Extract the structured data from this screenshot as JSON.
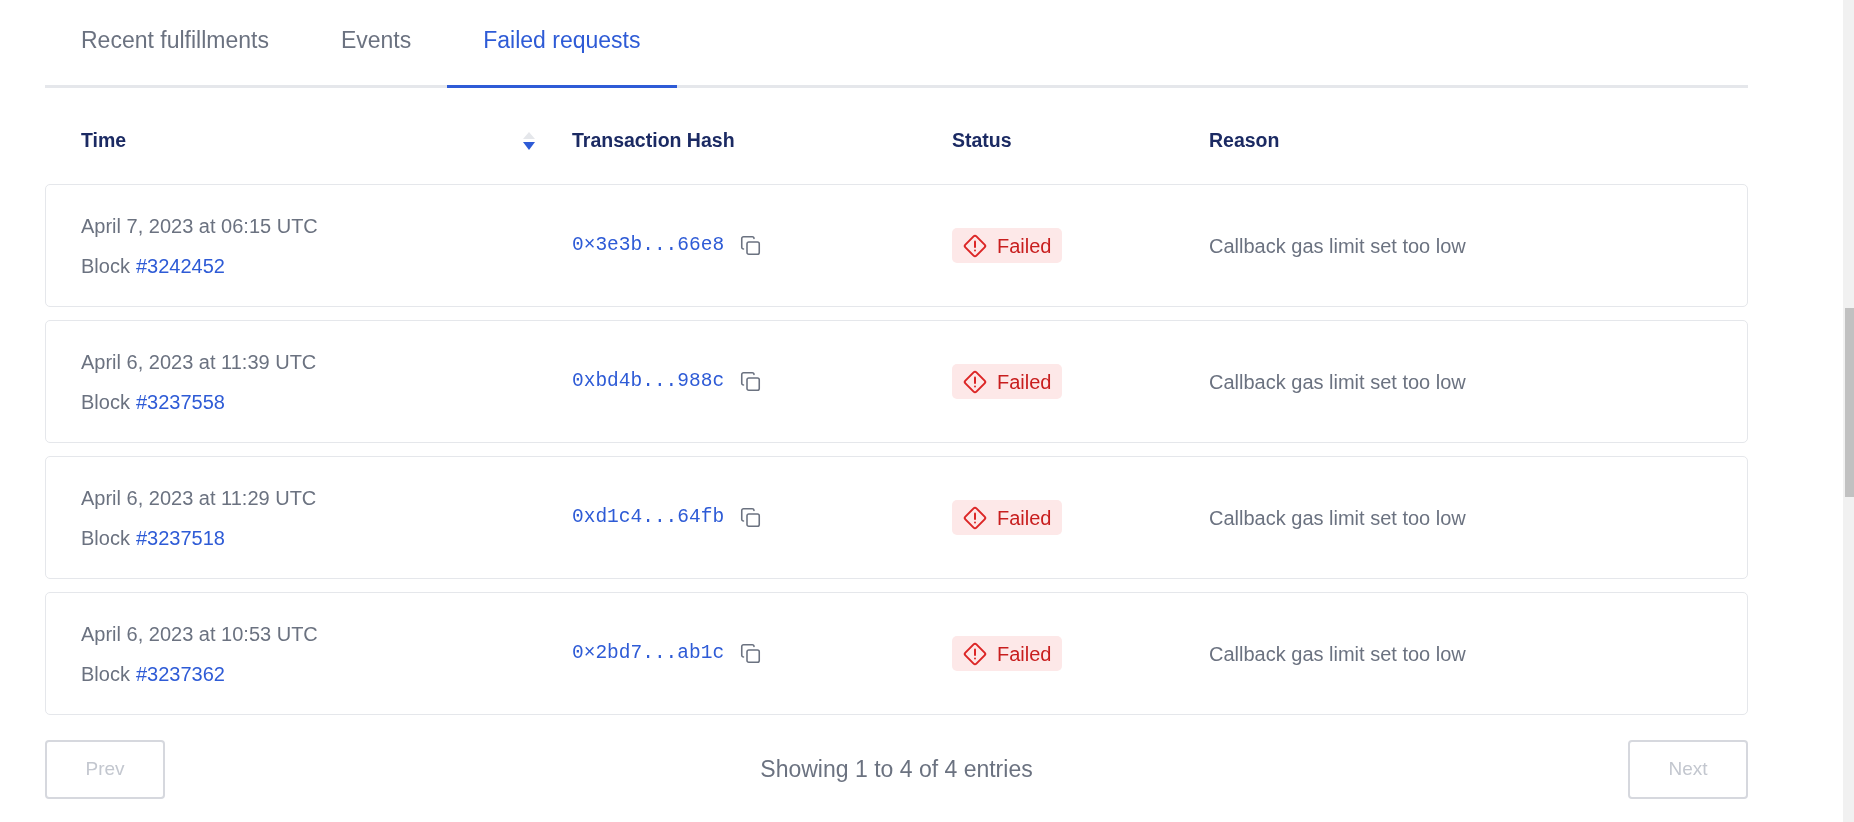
{
  "tabs": [
    {
      "label": "Recent fulfillments",
      "selected": false
    },
    {
      "label": "Events",
      "selected": false
    },
    {
      "label": "Failed requests",
      "selected": true
    }
  ],
  "table": {
    "columns": [
      {
        "label": "Time",
        "sort_descending": true
      },
      {
        "label": "Transaction Hash"
      },
      {
        "label": "Status"
      },
      {
        "label": "Reason"
      }
    ],
    "rows": [
      {
        "time": "April 7, 2023 at 06:15 UTC",
        "block_label": "Block",
        "block": "#3242452",
        "hash": "0×3e3b...66e8",
        "status": "Failed",
        "reason": "Callback gas limit set too low"
      },
      {
        "time": "April 6, 2023 at 11:39 UTC",
        "block_label": "Block",
        "block": "#3237558",
        "hash": "0xbd4b...988c",
        "status": "Failed",
        "reason": "Callback gas limit set too low"
      },
      {
        "time": "April 6, 2023 at 11:29 UTC",
        "block_label": "Block",
        "block": "#3237518",
        "hash": "0xd1c4...64fb",
        "status": "Failed",
        "reason": "Callback gas limit set too low"
      },
      {
        "time": "April 6, 2023 at 10:53 UTC",
        "block_label": "Block",
        "block": "#3237362",
        "hash": "0×2bd7...ab1c",
        "status": "Failed",
        "reason": "Callback gas limit set too low"
      }
    ]
  },
  "pagination": {
    "prev": {
      "label": "Prev",
      "disabled": true
    },
    "summary": "Showing 1 to 4 of 4 entries",
    "next": {
      "label": "Next",
      "disabled": true
    }
  }
}
